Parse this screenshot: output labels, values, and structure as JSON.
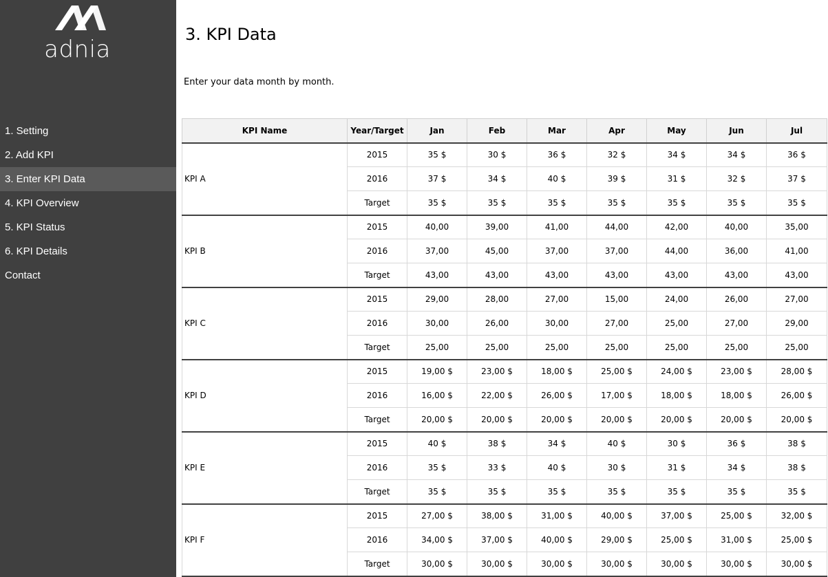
{
  "brand": {
    "name": "adnia",
    "logo_icon": "adnia-logo-icon"
  },
  "sidebar": {
    "items": [
      {
        "label": "1. Setting",
        "active": false
      },
      {
        "label": "2. Add KPI",
        "active": false
      },
      {
        "label": "3. Enter KPI Data",
        "active": true
      },
      {
        "label": "4. KPI Overview",
        "active": false
      },
      {
        "label": "5. KPI Status",
        "active": false
      },
      {
        "label": "6. KPI Details",
        "active": false
      },
      {
        "label": "Contact",
        "active": false
      }
    ]
  },
  "main": {
    "title": "3. KPI Data",
    "subtitle": "Enter your data month by month."
  },
  "table": {
    "headers": [
      "KPI Name",
      "Year/Target",
      "Jan",
      "Feb",
      "Mar",
      "Apr",
      "May",
      "Jun",
      "Jul"
    ],
    "kpis": [
      {
        "name": "KPI A",
        "rows": [
          {
            "label": "2015",
            "values": [
              "35 $",
              "30 $",
              "36 $",
              "32 $",
              "34 $",
              "34 $",
              "36 $"
            ]
          },
          {
            "label": "2016",
            "values": [
              "37 $",
              "34 $",
              "40 $",
              "39 $",
              "31 $",
              "32 $",
              "37 $"
            ]
          },
          {
            "label": "Target",
            "values": [
              "35 $",
              "35 $",
              "35 $",
              "35 $",
              "35 $",
              "35 $",
              "35 $"
            ]
          }
        ]
      },
      {
        "name": "KPI B",
        "rows": [
          {
            "label": "2015",
            "values": [
              "40,00",
              "39,00",
              "41,00",
              "44,00",
              "42,00",
              "40,00",
              "35,00"
            ]
          },
          {
            "label": "2016",
            "values": [
              "37,00",
              "45,00",
              "37,00",
              "37,00",
              "44,00",
              "36,00",
              "41,00"
            ]
          },
          {
            "label": "Target",
            "values": [
              "43,00",
              "43,00",
              "43,00",
              "43,00",
              "43,00",
              "43,00",
              "43,00"
            ]
          }
        ]
      },
      {
        "name": "KPI C",
        "rows": [
          {
            "label": "2015",
            "values": [
              "29,00",
              "28,00",
              "27,00",
              "15,00",
              "24,00",
              "26,00",
              "27,00"
            ]
          },
          {
            "label": "2016",
            "values": [
              "30,00",
              "26,00",
              "30,00",
              "27,00",
              "25,00",
              "27,00",
              "29,00"
            ]
          },
          {
            "label": "Target",
            "values": [
              "25,00",
              "25,00",
              "25,00",
              "25,00",
              "25,00",
              "25,00",
              "25,00"
            ]
          }
        ]
      },
      {
        "name": "KPI D",
        "rows": [
          {
            "label": "2015",
            "values": [
              "19,00 $",
              "23,00 $",
              "18,00 $",
              "25,00 $",
              "24,00 $",
              "23,00 $",
              "28,00 $"
            ]
          },
          {
            "label": "2016",
            "values": [
              "16,00 $",
              "22,00 $",
              "26,00 $",
              "17,00 $",
              "18,00 $",
              "18,00 $",
              "26,00 $"
            ]
          },
          {
            "label": "Target",
            "values": [
              "20,00 $",
              "20,00 $",
              "20,00 $",
              "20,00 $",
              "20,00 $",
              "20,00 $",
              "20,00 $"
            ]
          }
        ]
      },
      {
        "name": "KPI E",
        "rows": [
          {
            "label": "2015",
            "values": [
              "40 $",
              "38 $",
              "34 $",
              "40 $",
              "30 $",
              "36 $",
              "38 $"
            ]
          },
          {
            "label": "2016",
            "values": [
              "35 $",
              "33 $",
              "40 $",
              "30 $",
              "31 $",
              "34 $",
              "38 $"
            ]
          },
          {
            "label": "Target",
            "values": [
              "35 $",
              "35 $",
              "35 $",
              "35 $",
              "35 $",
              "35 $",
              "35 $"
            ]
          }
        ]
      },
      {
        "name": "KPI F",
        "rows": [
          {
            "label": "2015",
            "values": [
              "27,00 $",
              "38,00 $",
              "31,00 $",
              "40,00 $",
              "37,00 $",
              "25,00 $",
              "32,00 $"
            ]
          },
          {
            "label": "2016",
            "values": [
              "34,00 $",
              "37,00 $",
              "40,00 $",
              "29,00 $",
              "25,00 $",
              "31,00 $",
              "25,00 $"
            ]
          },
          {
            "label": "Target",
            "values": [
              "30,00 $",
              "30,00 $",
              "30,00 $",
              "30,00 $",
              "30,00 $",
              "30,00 $",
              "30,00 $"
            ]
          }
        ]
      }
    ]
  },
  "colors": {
    "sidebar_bg": "#404040",
    "active_item_bg": "#5a5a5a",
    "header_bg": "#f2f2f2"
  }
}
